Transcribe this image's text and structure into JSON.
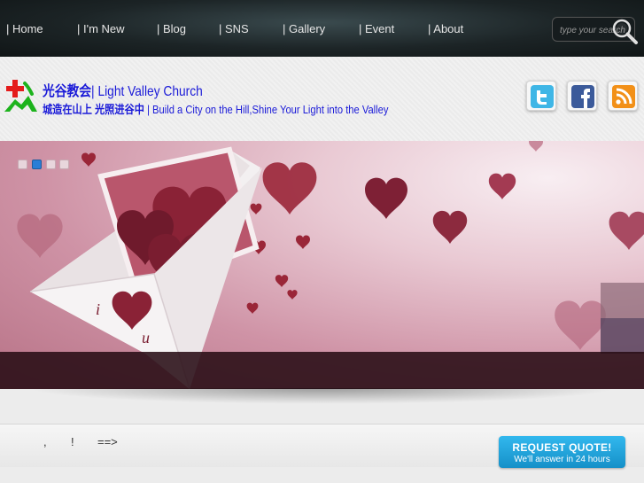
{
  "nav": {
    "items": [
      {
        "label": "| Home"
      },
      {
        "label": "| I'm New"
      },
      {
        "label": "| Blog"
      },
      {
        "label": "| SNS"
      },
      {
        "label": "| Gallery"
      },
      {
        "label": "| Event"
      },
      {
        "label": "| About"
      }
    ]
  },
  "search": {
    "placeholder": "type your search"
  },
  "header": {
    "title_cn": "光谷教会",
    "title_en": "| Light Valley Church",
    "motto_cn": "城造在山上 光照进谷中",
    "motto_en": "| Build a City on the Hill,Shine Your Light into the Valley"
  },
  "social": [
    {
      "icon": "twitter-icon"
    },
    {
      "icon": "facebook-icon"
    },
    {
      "icon": "rss-icon"
    }
  ],
  "slider": {
    "dots": [
      {
        "active": false
      },
      {
        "active": true
      },
      {
        "active": false
      },
      {
        "active": false
      }
    ],
    "letter_text": [
      "i",
      "u"
    ]
  },
  "ticker": {
    "parts": [
      ",",
      "!",
      "==>"
    ]
  },
  "quote": {
    "title": "REQUEST QUOTE!",
    "subtitle": "We'll answer in 24 hours"
  },
  "colors": {
    "topbar": "#1c2426",
    "title": "#1a1ad8",
    "quote": "#1fa4dc",
    "active_dot": "#2a7ed6"
  }
}
